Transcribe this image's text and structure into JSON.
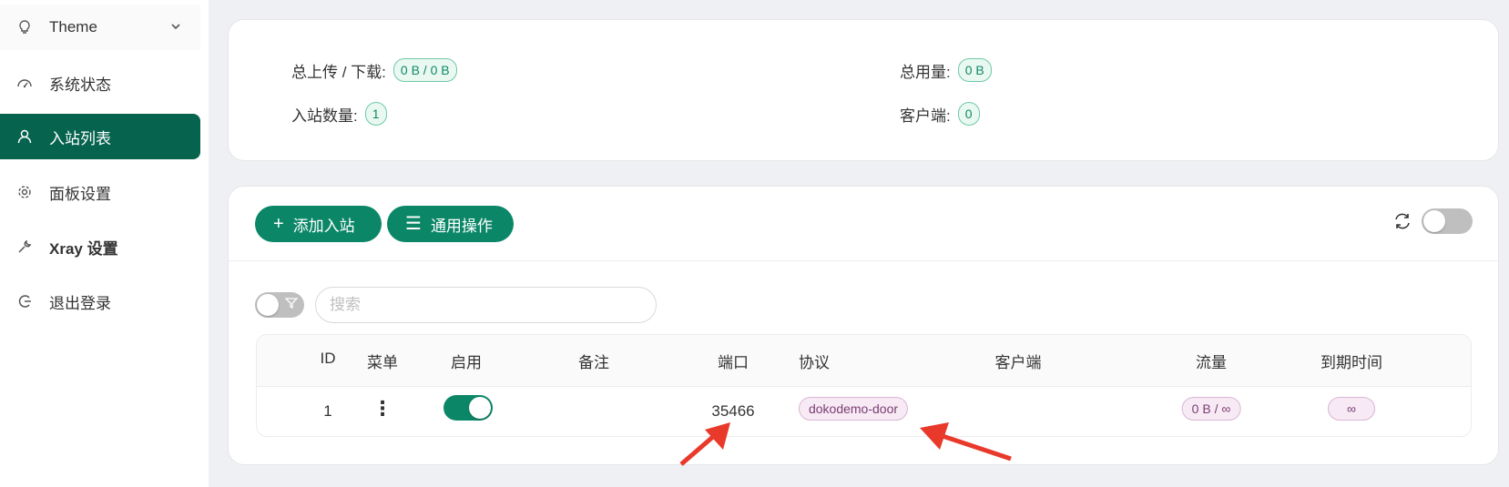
{
  "sidebar": {
    "theme": "Theme",
    "items": [
      {
        "label": "系统状态",
        "icon": "dashboard-icon"
      },
      {
        "label": "入站列表",
        "icon": "user-icon",
        "active": true
      },
      {
        "label": "面板设置",
        "icon": "gear-icon"
      },
      {
        "label": "Xray 设置",
        "icon": "wrench-icon"
      },
      {
        "label": "退出登录",
        "icon": "logout-icon"
      }
    ]
  },
  "stats": {
    "traffic_label": "总上传 / 下载:",
    "traffic_value": "0 B / 0 B",
    "usage_label": "总用量:",
    "usage_value": "0 B",
    "inbound_count_label": "入站数量:",
    "inbound_count_value": "1",
    "clients_label": "客户端:",
    "clients_value": "0"
  },
  "toolbar": {
    "add_inbound": "添加入站",
    "general_actions": "通用操作",
    "search_placeholder": "搜索"
  },
  "table": {
    "columns": [
      "ID",
      "菜单",
      "启用",
      "备注",
      "端口",
      "协议",
      "客户端",
      "流量",
      "到期时间"
    ],
    "rows": [
      {
        "id": "1",
        "menu": "⋮",
        "enabled": true,
        "remark": "",
        "port": "35466",
        "protocol": "dokodemo-door",
        "clients": "",
        "traffic": "0 B / ∞",
        "expiry": "∞"
      }
    ]
  },
  "colors": {
    "accent": "#0b8768",
    "active_sidebar": "#05634e",
    "arrow": "#e8392b"
  }
}
